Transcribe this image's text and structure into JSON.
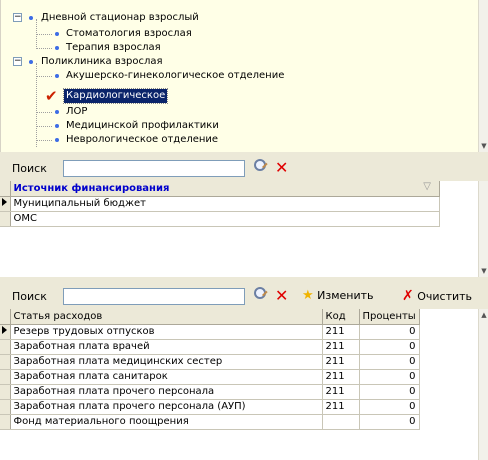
{
  "tree": {
    "items": [
      {
        "label": "Дневной стационар взрослый",
        "expander": "−"
      },
      {
        "label": "Стоматология взрослая"
      },
      {
        "label": "Терапия взрослая"
      },
      {
        "label": "Поликлиника взрослая",
        "expander": "−"
      },
      {
        "label": "Акушерско-гинекологическое отделение"
      },
      {
        "label": "Кардиологическое",
        "checked": "✔"
      },
      {
        "label": "ЛОР"
      },
      {
        "label": "Медицинской профилактики"
      },
      {
        "label": "Неврологическое отделение"
      }
    ]
  },
  "search1": {
    "label": "Поиск",
    "value": ""
  },
  "funding": {
    "column": "Источник финансирования",
    "filter_icon": "▽",
    "rows": [
      "Муниципальный бюджет",
      "ОМС"
    ]
  },
  "search2": {
    "label": "Поиск",
    "value": "",
    "edit_label": "Изменить",
    "clear_label": "Очистить"
  },
  "expenses": {
    "columns": {
      "name": "Статья расходов",
      "code": "Код",
      "percent": "Проценты"
    },
    "rows": [
      {
        "name": "Резерв трудовых отпусков",
        "code": "211",
        "percent": "0"
      },
      {
        "name": "Заработная плата врачей",
        "code": "211",
        "percent": "0"
      },
      {
        "name": "Заработная плата медицинских сестер",
        "code": "211",
        "percent": "0"
      },
      {
        "name": "Заработная плата санитарок",
        "code": "211",
        "percent": "0"
      },
      {
        "name": "Заработная плата прочего персонала",
        "code": "211",
        "percent": "0"
      },
      {
        "name": "Заработная плата прочего персонала (АУП)",
        "code": "211",
        "percent": "0"
      },
      {
        "name": "Фонд материального поощрения",
        "code": "",
        "percent": "0"
      }
    ]
  },
  "colors": {
    "selection": "#0a246a",
    "header_text": "#0000cc",
    "tree_bg": "#ffffe7",
    "accent_red": "#e00000"
  }
}
